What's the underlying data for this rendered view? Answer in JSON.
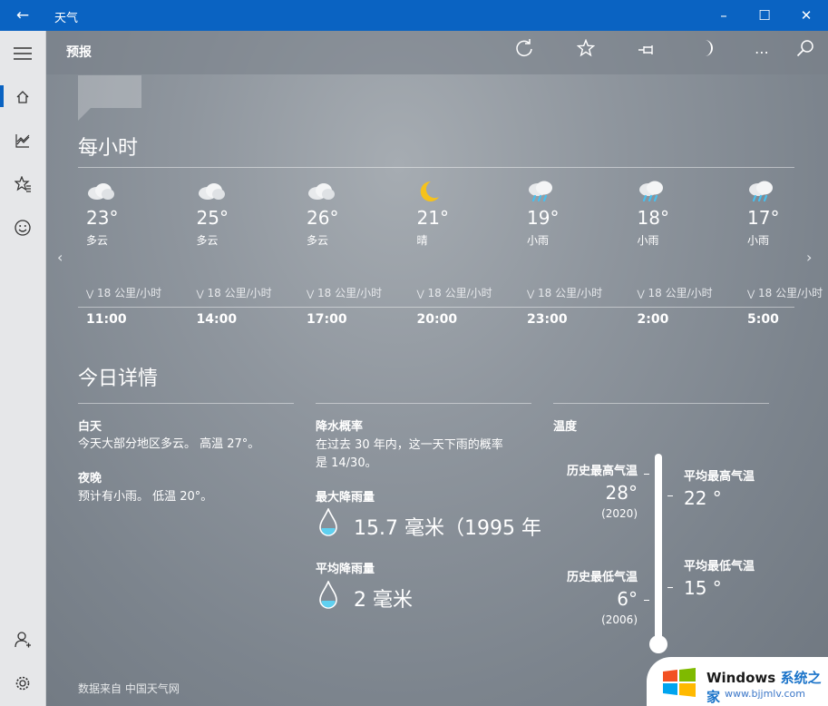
{
  "window": {
    "title": "天气"
  },
  "header": {
    "page_title": "预报"
  },
  "hourly": {
    "title": "每小时",
    "items": [
      {
        "icon": "cloud-icon",
        "temp": "23°",
        "desc": "多云",
        "wind": "18 公里/小时",
        "time": "11:00"
      },
      {
        "icon": "cloud-icon",
        "temp": "25°",
        "desc": "多云",
        "wind": "18 公里/小时",
        "time": "14:00"
      },
      {
        "icon": "cloud-icon",
        "temp": "26°",
        "desc": "多云",
        "wind": "18 公里/小时",
        "time": "17:00"
      },
      {
        "icon": "moon-icon",
        "temp": "21°",
        "desc": "晴",
        "wind": "18 公里/小时",
        "time": "20:00"
      },
      {
        "icon": "rain-cloud-icon",
        "temp": "19°",
        "desc": "小雨",
        "wind": "18 公里/小时",
        "time": "23:00"
      },
      {
        "icon": "rain-cloud-icon",
        "temp": "18°",
        "desc": "小雨",
        "wind": "18 公里/小时",
        "time": "2:00"
      },
      {
        "icon": "rain-cloud-icon",
        "temp": "17°",
        "desc": "小雨",
        "wind": "18 公里/小时",
        "time": "5:00"
      }
    ]
  },
  "details": {
    "title": "今日详情",
    "day_label": "白天",
    "day_text": "今天大部分地区多云。 高温 27°。",
    "night_label": "夜晚",
    "night_text": "预计有小雨。 低温 20°。",
    "precip_label": "降水概率",
    "precip_text_1": "在过去 30 年内，这一天下雨的概率",
    "precip_text_2": "是 14/30。",
    "max_rain_label": "最大降雨量",
    "max_rain_value": "15.7 毫米（1995 年",
    "avg_rain_label": "平均降雨量",
    "avg_rain_value": "2 毫米",
    "temp_label": "温度",
    "hist_high_label": "历史最高气温",
    "hist_high_value": "28°",
    "hist_high_year": "(2020)",
    "hist_low_label": "历史最低气温",
    "hist_low_value": "6°",
    "hist_low_year": "(2006)",
    "avg_high_label": "平均最高气温",
    "avg_high_value": "22 °",
    "avg_low_label": "平均最低气温",
    "avg_low_value": "15 °"
  },
  "footer": {
    "source": "数据来自 中国天气网"
  },
  "watermark": {
    "brand": "Windows",
    "brand_cn": "系统之家",
    "url": "www.bjjmlv.com"
  },
  "colors": {
    "titlebar": "#0a63c2",
    "accent": "#0a63c2"
  }
}
